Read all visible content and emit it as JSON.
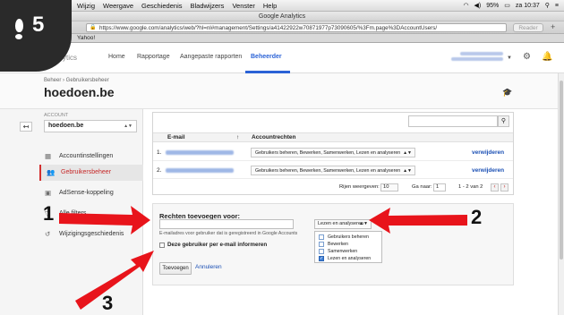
{
  "menubar": {
    "items": [
      "Wijzig",
      "Weergave",
      "Geschiedenis",
      "Bladwijzers",
      "Venster",
      "Help"
    ],
    "battery": "95%",
    "time": "za 10:37"
  },
  "window": {
    "title": "Google Analytics"
  },
  "browser": {
    "url": "https://www.google.com/analytics/web/?hl=nl#management/Settings/a41422922w70871977p73090605/%3Fm.page%3DAccountUsers/",
    "reader_label": "Reader",
    "bookmarks": [
      "ey",
      "Yahoo!"
    ]
  },
  "ga_header": {
    "logo": "Analytics",
    "nav": [
      "Home",
      "Rapportage",
      "Aangepaste rapporten",
      "Beheerder"
    ]
  },
  "breadcrumb": "Beheer › Gebruikersbeheer",
  "page_title": "hoedoen.be",
  "sidebar": {
    "account_label": "ACCOUNT",
    "account_value": "hoedoen.be",
    "items": [
      "Accountinstellingen",
      "Gebruikersbeheer",
      "AdSense-koppeling",
      "Alle filters",
      "Wijzigingsgeschiedenis"
    ]
  },
  "users_table": {
    "col_email": "E-mail",
    "col_rights": "Accountrechten",
    "rows": [
      {
        "num": "1.",
        "rights": "Gebruikers beheren, Bewerken, Samenwerken, Lezen en analyseren",
        "delete": "verwijderen"
      },
      {
        "num": "2.",
        "rights": "Gebruikers beheren, Bewerken, Samenwerken, Lezen en analyseren",
        "delete": "verwijderen"
      }
    ],
    "pager": {
      "rows_label": "Rijen weergeven:",
      "rows_value": "10",
      "goto_label": "Ga naar:",
      "goto_value": "1",
      "range": "1 - 2 van 2"
    }
  },
  "add_panel": {
    "title": "Rechten toevoegen voor:",
    "email_hint": "E-mailadres voor gebruiker dat is geregistreerd in Google Accounts",
    "notify_label": "Deze gebruiker per e-mail informeren",
    "add_button": "Toevoegen",
    "cancel_link": "Annuleren",
    "perm_selected": "Lezen en analyseren",
    "perm_options": [
      {
        "label": "Gebruikers beheren",
        "checked": false
      },
      {
        "label": "Bewerken",
        "checked": false
      },
      {
        "label": "Samenwerken",
        "checked": false
      },
      {
        "label": "Lezen en analyseren",
        "checked": true
      }
    ]
  },
  "overlay": {
    "step_badge": "5",
    "annotations": [
      "1",
      "2",
      "3"
    ],
    "arrow_color": "#e8141b"
  }
}
